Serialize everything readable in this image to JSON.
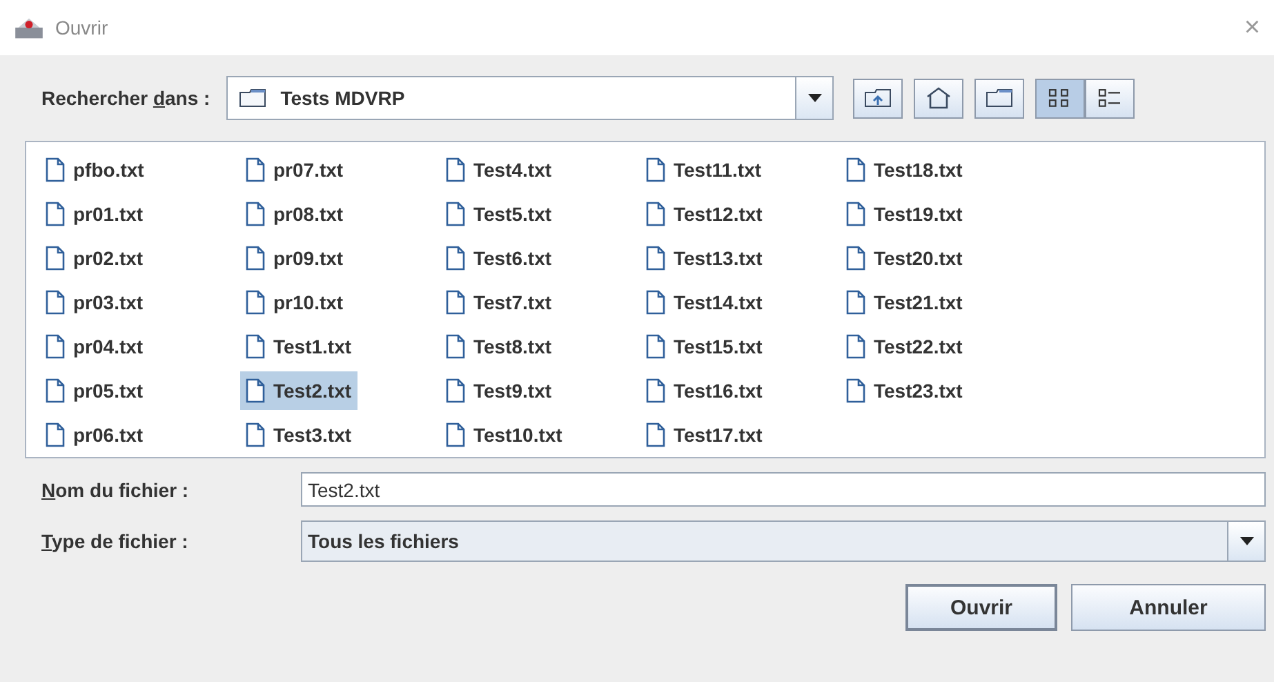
{
  "window": {
    "title": "Ouvrir",
    "close": "×"
  },
  "look_in": {
    "label": {
      "before": "Rechercher ",
      "mnemonic": "d",
      "after": "ans :"
    },
    "value": "Tests MDVRP"
  },
  "files": [
    {
      "name": "pfbo.txt",
      "selected": false
    },
    {
      "name": "pr01.txt",
      "selected": false
    },
    {
      "name": "pr02.txt",
      "selected": false
    },
    {
      "name": "pr03.txt",
      "selected": false
    },
    {
      "name": "pr04.txt",
      "selected": false
    },
    {
      "name": "pr05.txt",
      "selected": false
    },
    {
      "name": "pr06.txt",
      "selected": false
    },
    {
      "name": "pr07.txt",
      "selected": false
    },
    {
      "name": "pr08.txt",
      "selected": false
    },
    {
      "name": "pr09.txt",
      "selected": false
    },
    {
      "name": "pr10.txt",
      "selected": false
    },
    {
      "name": "Test1.txt",
      "selected": false
    },
    {
      "name": "Test2.txt",
      "selected": true
    },
    {
      "name": "Test3.txt",
      "selected": false
    },
    {
      "name": "Test4.txt",
      "selected": false
    },
    {
      "name": "Test5.txt",
      "selected": false
    },
    {
      "name": "Test6.txt",
      "selected": false
    },
    {
      "name": "Test7.txt",
      "selected": false
    },
    {
      "name": "Test8.txt",
      "selected": false
    },
    {
      "name": "Test9.txt",
      "selected": false
    },
    {
      "name": "Test10.txt",
      "selected": false
    },
    {
      "name": "Test11.txt",
      "selected": false
    },
    {
      "name": "Test12.txt",
      "selected": false
    },
    {
      "name": "Test13.txt",
      "selected": false
    },
    {
      "name": "Test14.txt",
      "selected": false
    },
    {
      "name": "Test15.txt",
      "selected": false
    },
    {
      "name": "Test16.txt",
      "selected": false
    },
    {
      "name": "Test17.txt",
      "selected": false
    },
    {
      "name": "Test18.txt",
      "selected": false
    },
    {
      "name": "Test19.txt",
      "selected": false
    },
    {
      "name": "Test20.txt",
      "selected": false
    },
    {
      "name": "Test21.txt",
      "selected": false
    },
    {
      "name": "Test22.txt",
      "selected": false
    },
    {
      "name": "Test23.txt",
      "selected": false
    }
  ],
  "file_name": {
    "label": {
      "mnemonic": "N",
      "after": "om du fichier :"
    },
    "value": "Test2.txt"
  },
  "file_type": {
    "label": {
      "mnemonic": "T",
      "after": "ype de fichier :"
    },
    "value": "Tous les fichiers"
  },
  "buttons": [
    "Ouvrir",
    "Annuler"
  ]
}
